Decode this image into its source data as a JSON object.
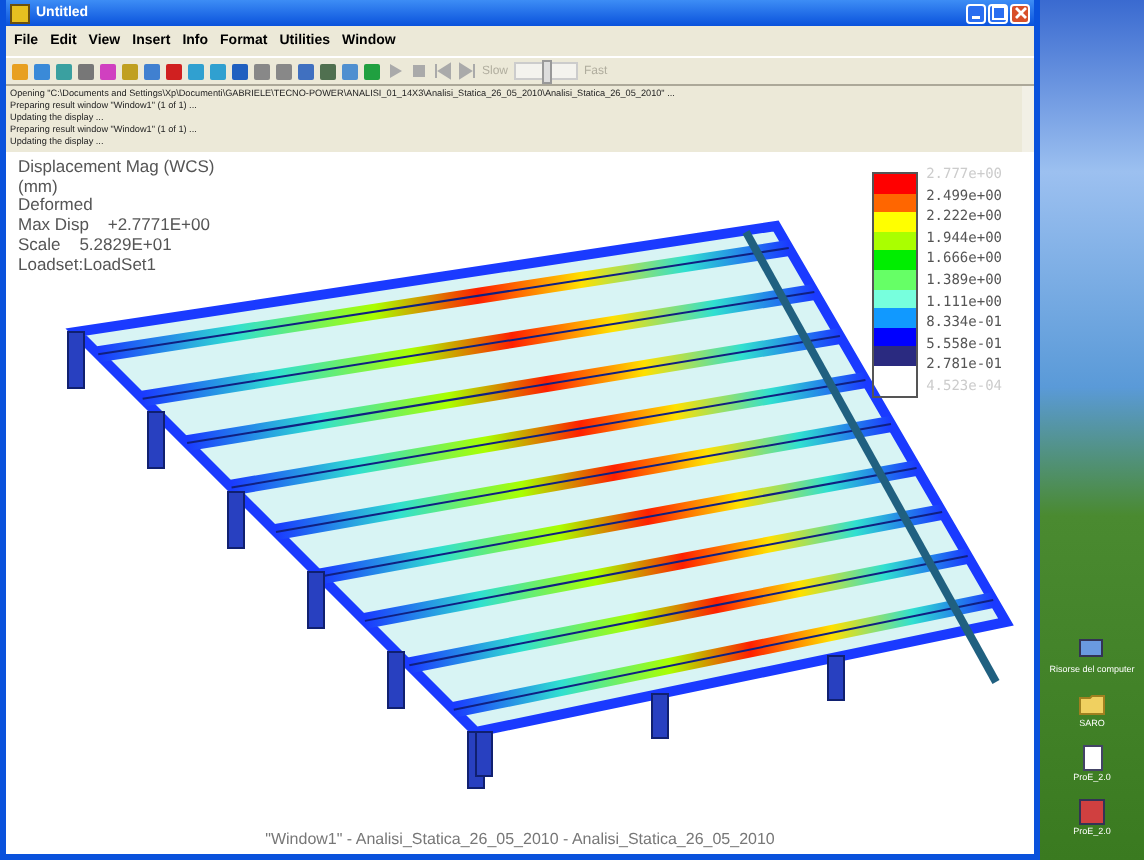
{
  "window": {
    "title": "Untitled"
  },
  "menu": [
    "File",
    "Edit",
    "View",
    "Insert",
    "Info",
    "Format",
    "Utilities",
    "Window"
  ],
  "toolbar": {
    "slow_label": "Slow",
    "fast_label": "Fast",
    "disabled": true,
    "level": 0.5
  },
  "log": [
    "Opening \"C:\\Documents and Settings\\Xp\\Documenti\\GABRIELE\\TECNO-POWER\\ANALISI_01_14X3\\Analisi_Statica_26_05_2010\\Analisi_Statica_26_05_2010\" ...",
    "Preparing result window \"Window1\" (1 of 1) ...",
    "Updating the display ...",
    "Preparing result window \"Window1\" (1 of 1) ...",
    "Updating the display ..."
  ],
  "info": [
    "Displacement Mag (WCS)",
    "(mm)",
    "Deformed",
    "Max Disp    +2.7771E+00",
    "Scale    5.2829E+01",
    "Loadset:LoadSet1"
  ],
  "legend": {
    "values": [
      "2.777e+00",
      "2.499e+00",
      "2.222e+00",
      "1.944e+00",
      "1.666e+00",
      "1.389e+00",
      "1.111e+00",
      "8.334e-01",
      "5.558e-01",
      "2.781e-01",
      "4.523e-04"
    ],
    "bands": [
      {
        "color": "#ff0000"
      },
      {
        "color": "#ff6600"
      },
      {
        "color": "#ffff00"
      },
      {
        "color": "#aaff00"
      },
      {
        "color": "#00ee00"
      },
      {
        "color": "#66ff66"
      },
      {
        "color": "#77ffdd"
      },
      {
        "color": "#1199ff"
      },
      {
        "color": "#0000ff"
      },
      {
        "color": "#2a2a80"
      }
    ]
  },
  "caption": "\"Window1\" - Analisi_Statica_26_05_2010 - Analisi_Statica_26_05_2010",
  "desktop_icons": [
    {
      "label": "Risorse del computer",
      "kind": "computer"
    },
    {
      "label": "SARO",
      "kind": "folder"
    },
    {
      "label": "ProE_2.0",
      "kind": "doc"
    },
    {
      "label": "ProE_2.0",
      "kind": "app"
    }
  ]
}
